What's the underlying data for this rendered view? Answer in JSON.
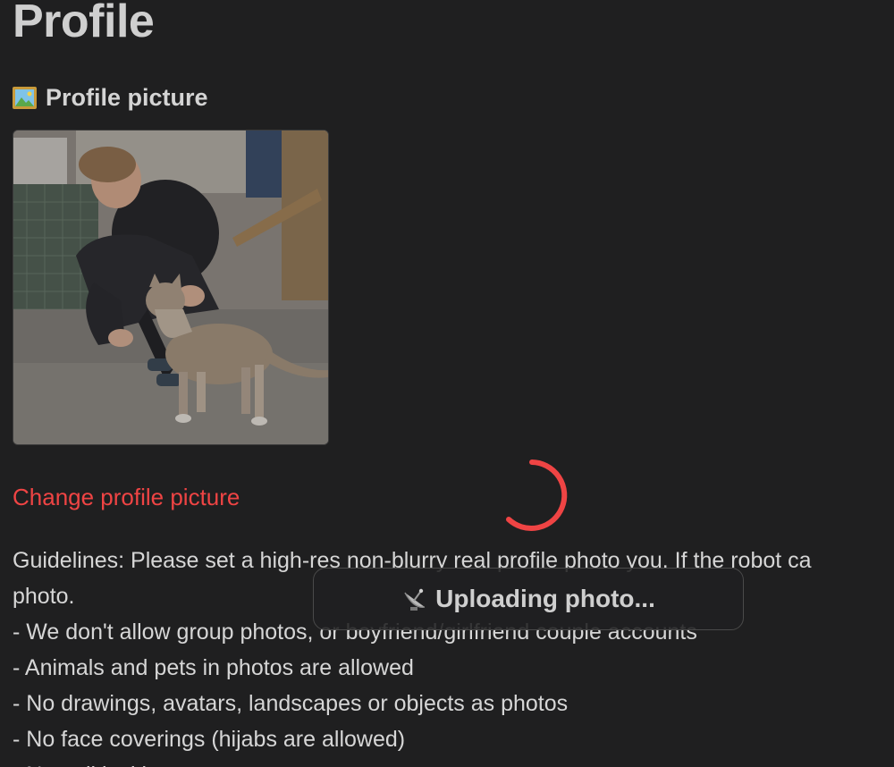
{
  "page": {
    "title": "Profile"
  },
  "profile_picture": {
    "heading": "Profile picture",
    "heading_icon": "framed-picture-icon",
    "change_link": "Change profile picture"
  },
  "guidelines": {
    "lines": [
      "Guidelines: Please set a high-res non-blurry real profile photo you. If the robot ca",
      "photo.",
      "- We don't allow group photos, or boyfriend/girlfriend couple accounts",
      "- Animals and pets in photos are allowed",
      "- No drawings, avatars, landscapes or objects as photos",
      "- No face coverings (hijabs are allowed)",
      "- No political imagery"
    ]
  },
  "upload_toast": {
    "icon": "satellite-dish-icon",
    "text": "Uploading photo..."
  },
  "colors": {
    "background": "#1f1f20",
    "accent": "#ef4444",
    "text": "#d6d6d6"
  }
}
